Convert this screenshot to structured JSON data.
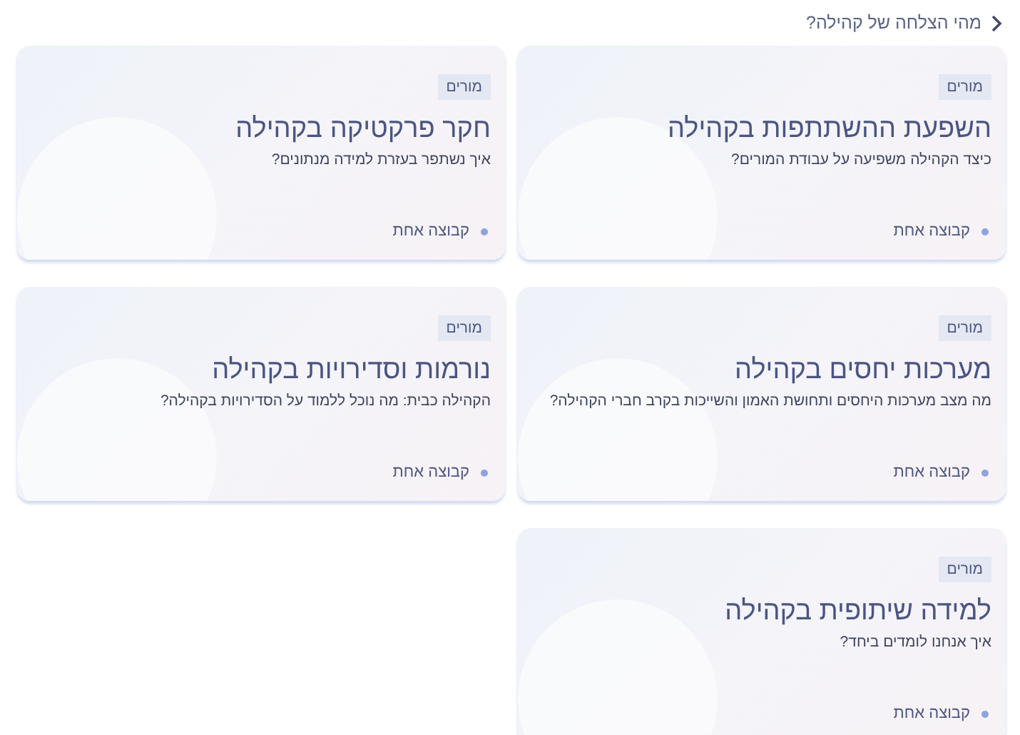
{
  "header": {
    "title": "מהי הצלחה של קהילה?"
  },
  "cards": [
    {
      "tag": "מורים",
      "title": "השפעת ההשתתפות בקהילה",
      "subtitle": "כיצד הקהילה משפיעה על עבודת המורים?",
      "group": "קבוצה אחת"
    },
    {
      "tag": "מורים",
      "title": "חקר פרקטיקה בקהילה",
      "subtitle": "איך נשתפר בעזרת למידה מנתונים?",
      "group": "קבוצה אחת"
    },
    {
      "tag": "מורים",
      "title": "מערכות יחסים בקהילה",
      "subtitle": "מה מצב מערכות היחסים ותחושת האמון והשייכות בקרב חברי הקהילה?",
      "group": "קבוצה אחת"
    },
    {
      "tag": "מורים",
      "title": "נורמות וסדירויות בקהילה",
      "subtitle": "הקהילה כבית: מה נוכל ללמוד על הסדירויות בקהילה?",
      "group": "קבוצה אחת"
    },
    {
      "tag": "מורים",
      "title": "למידה שיתופית בקהילה",
      "subtitle": "איך אנחנו לומדים ביחד?",
      "group": "קבוצה אחת"
    }
  ]
}
